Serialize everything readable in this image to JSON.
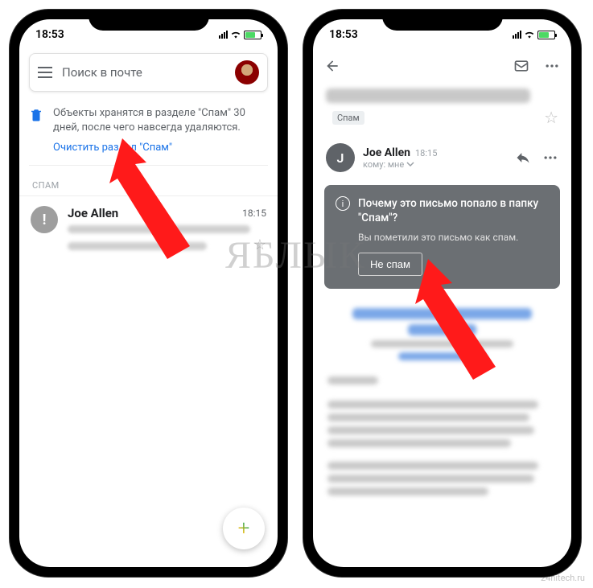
{
  "status": {
    "time": "18:53"
  },
  "left": {
    "search_placeholder": "Поиск в почте",
    "banner_text": "Объекты хранятся в разделе \"Спам\" 30 дней, после чего навсегда удаляются.",
    "banner_link": "Очистить раздел \"Спам\"",
    "section": "СПАМ",
    "mail": {
      "sender": "Joe Allen",
      "time": "18:15"
    }
  },
  "right": {
    "chip": "Спам",
    "sender": "Joe Allen",
    "time": "18:15",
    "to": "кому: мне",
    "card_title": "Почему это письмо попало в папку \"Спам\"?",
    "card_sub": "Вы пометили это письмо как спам.",
    "card_btn": "Не спам",
    "avatar_initial": "J"
  },
  "watermark": "ЯБЛЫК",
  "wm_small": "24hitech.ru"
}
